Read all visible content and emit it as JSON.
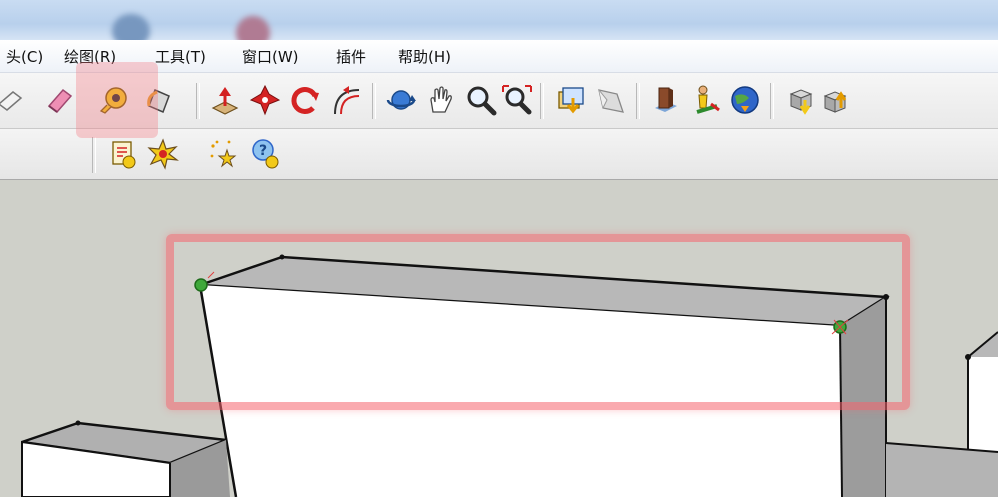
{
  "menu": {
    "items": [
      {
        "label": "头(C)"
      },
      {
        "label": "绘图(R)"
      },
      {
        "label": "工具(T)"
      },
      {
        "label": "窗口(W)"
      },
      {
        "label": "插件"
      },
      {
        "label": "帮助(H)"
      }
    ]
  },
  "toolbar_main": {
    "icons": [
      "follow-me-icon",
      "eraser-icon",
      "tape-measure-icon",
      "paint-bucket-icon",
      "push-pull-icon",
      "move-icon",
      "rotate-icon",
      "offset-icon",
      "orbit-icon",
      "pan-icon",
      "zoom-icon",
      "zoom-extents-icon",
      "previous-view-icon",
      "next-view-icon",
      "3d-warehouse-icon",
      "position-camera-icon",
      "google-earth-icon",
      "get-models-icon",
      "share-model-icon"
    ],
    "selected": "tape-measure-icon"
  },
  "toolbar_secondary": {
    "icons": [
      "report-icon",
      "explode-icon",
      "sparkle-icon",
      "help-icon"
    ]
  },
  "colors": {
    "highlight": "#f4707c",
    "viewport_bg": "#cfd0c9",
    "endpoint": "#3fa83a"
  }
}
